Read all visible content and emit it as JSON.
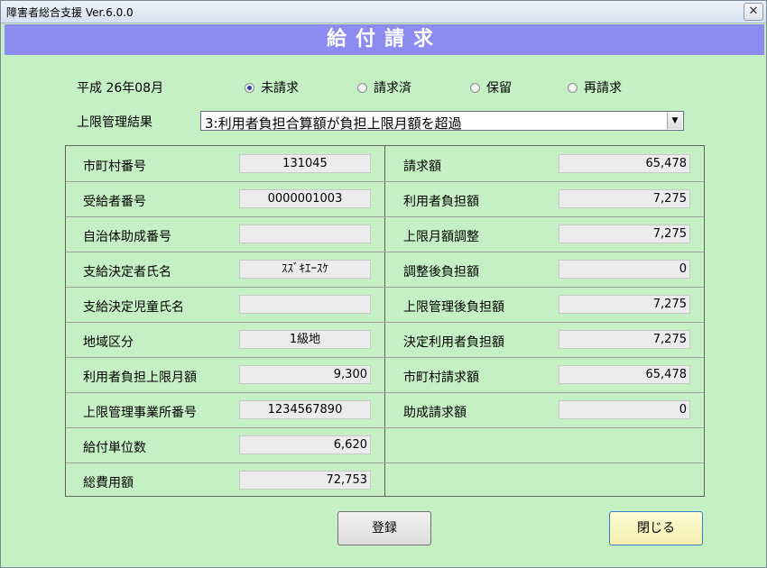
{
  "window": {
    "title": "障害者総合支援 Ver.6.0.0",
    "close_glyph": "✕"
  },
  "header": {
    "title": "給付請求"
  },
  "period": "平成 26年08月",
  "status_options": [
    {
      "label": "未請求",
      "selected": true
    },
    {
      "label": "請求済",
      "selected": false
    },
    {
      "label": "保留",
      "selected": false
    },
    {
      "label": "再請求",
      "selected": false
    }
  ],
  "limit_result": {
    "label": "上限管理結果",
    "value": "3:利用者負担合算額が負担上限月額を超過"
  },
  "left_fields": [
    {
      "label": "市町村番号",
      "value": "131045"
    },
    {
      "label": "受給者番号",
      "value": "0000001003"
    },
    {
      "label": "自治体助成番号",
      "value": ""
    },
    {
      "label": "支給決定者氏名",
      "value": "ｽｽﾞｷｴｰｽｹ"
    },
    {
      "label": "支給決定児童氏名",
      "value": ""
    },
    {
      "label": "地域区分",
      "value": "1級地"
    },
    {
      "label": "利用者負担上限月額",
      "value": "9,300"
    },
    {
      "label": "上限管理事業所番号",
      "value": "1234567890"
    },
    {
      "label": "給付単位数",
      "value": "6,620"
    },
    {
      "label": "総費用額",
      "value": "72,753"
    }
  ],
  "right_fields": [
    {
      "label": "請求額",
      "value": "65,478"
    },
    {
      "label": "利用者負担額",
      "value": "7,275"
    },
    {
      "label": "上限月額調整",
      "value": "7,275"
    },
    {
      "label": "調整後負担額",
      "value": "0"
    },
    {
      "label": "上限管理後負担額",
      "value": "7,275"
    },
    {
      "label": "決定利用者負担額",
      "value": "7,275"
    },
    {
      "label": "市町村請求額",
      "value": "65,478"
    },
    {
      "label": "助成請求額",
      "value": "0"
    }
  ],
  "buttons": {
    "register": "登録",
    "close": "閉じる"
  }
}
